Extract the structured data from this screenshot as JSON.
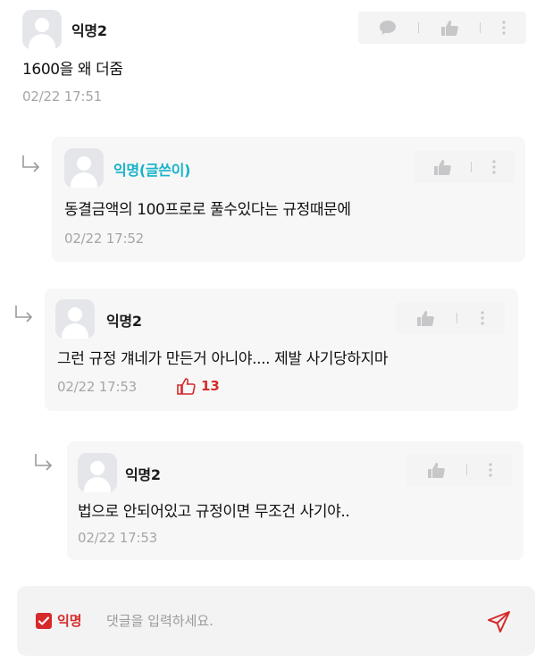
{
  "comments": [
    {
      "author": "익명2",
      "text": "1600을 왜 더줌",
      "time": "02/22 17:51"
    }
  ],
  "replies": [
    {
      "author": "익명(글쓴이)",
      "text": "동결금액의 100프로로 풀수있다는 규정때문에",
      "time": "02/22 17:52"
    },
    {
      "author": "익명2",
      "text": "그런 규정 걔네가 만든거 아니야.... 제발 사기당하지마",
      "time": "02/22 17:53",
      "likes": "13"
    },
    {
      "author": "익명2",
      "text": "법으로 안되어있고 규정이면 무조건 사기야..",
      "time": "02/22 17:53"
    }
  ],
  "composer": {
    "anon_label": "익명",
    "placeholder": "댓글을 입력하세요."
  },
  "colors": {
    "accent": "#d62a2a",
    "writer": "#16b3c7",
    "muted": "#a6a6a6"
  },
  "icons": [
    "avatar-icon",
    "message-icon",
    "thumbs-up-icon",
    "more-vertical-icon",
    "reply-arrow-icon",
    "checkbox-icon",
    "send-icon"
  ]
}
